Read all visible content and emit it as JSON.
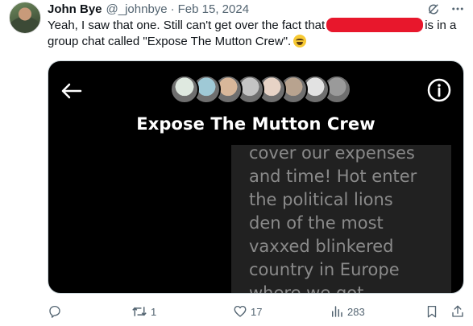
{
  "tweet": {
    "author_name": "John Bye",
    "handle": "@_johnbye",
    "separator": "·",
    "date": "Feb 15, 2024",
    "text_line1_before": "Yeah, I saw that one. Still can't get over the fact that",
    "text_line1_after": "is in a",
    "text_line2": "group chat called \"Expose The Mutton Crew\".",
    "emoji": "grinning-squinting-face-emoji"
  },
  "media": {
    "group_title": "Expose The Mutton Crew",
    "message_lines": [
      "cover our expenses",
      "and time! Hot enter",
      "the political lions",
      "den of the most",
      "vaxxed blinkered",
      "country in Europe",
      "where we got"
    ],
    "member_avatar_colors": [
      "#dfe9e0",
      "#9fc9d6",
      "#d8b79a",
      "#c4c4c4",
      "#e7d3c6",
      "#b8a38f",
      "#e2e2e2",
      "#9a9a9a"
    ]
  },
  "actions": {
    "reply_count": "",
    "repost_count": "1",
    "like_count": "17",
    "views_count": "283"
  },
  "colors": {
    "text_primary": "#0f1419",
    "text_secondary": "#536471",
    "redaction": "#e8172c",
    "media_bg": "#000000",
    "message_panel": "#212121"
  }
}
